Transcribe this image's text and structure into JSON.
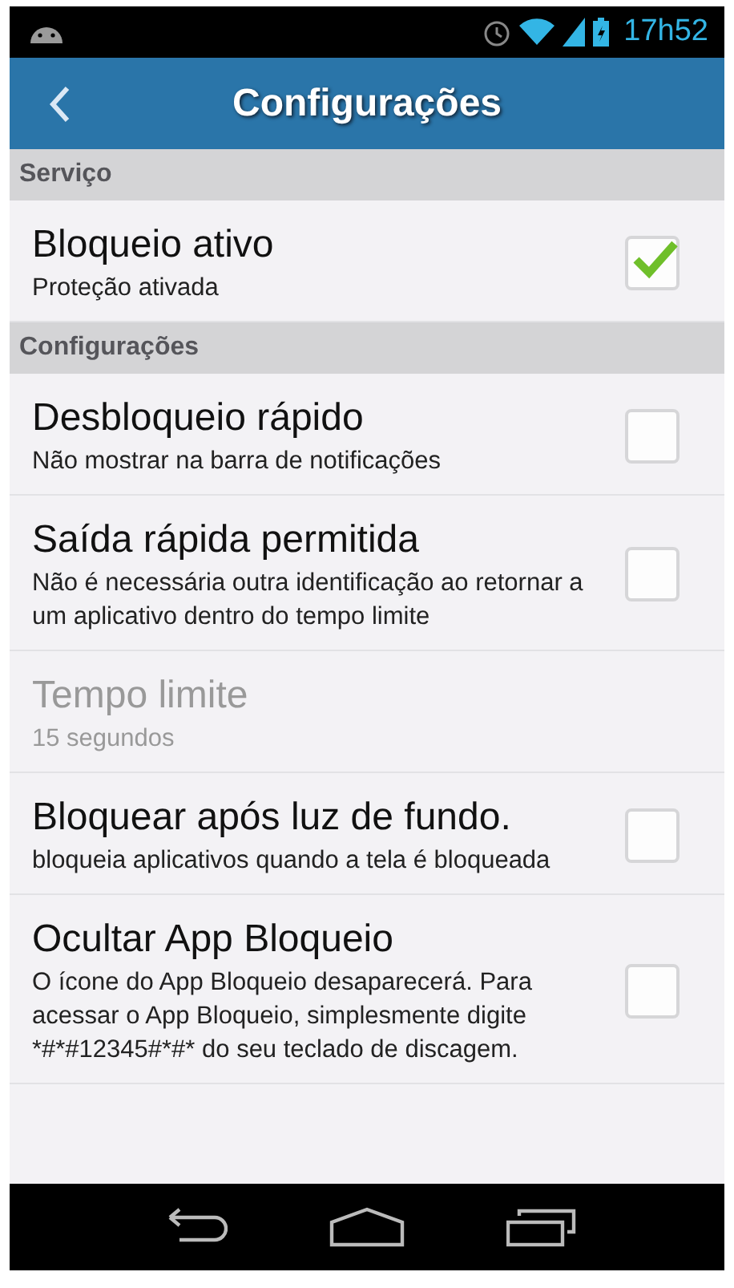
{
  "status_bar": {
    "time": "17h52"
  },
  "app_bar": {
    "title": "Configurações"
  },
  "sections": [
    {
      "header": "Serviço",
      "items": [
        {
          "kind": "checkbox",
          "title": "Bloqueio ativo",
          "summary": "Proteção ativada",
          "disabled": false,
          "checked": true
        }
      ]
    },
    {
      "header": "Configurações",
      "items": [
        {
          "kind": "checkbox",
          "title": "Desbloqueio rápido",
          "summary": "Não mostrar na barra de notificações",
          "disabled": false,
          "checked": false
        },
        {
          "kind": "checkbox",
          "title": "Saída rápida permitida",
          "summary": "Não é necessária outra identificação ao retornar a um aplicativo dentro do tempo limite",
          "disabled": false,
          "checked": false
        },
        {
          "kind": "plain",
          "title": "Tempo limite",
          "summary": "15 segundos",
          "disabled": true
        },
        {
          "kind": "checkbox",
          "title": "Bloquear após luz de fundo.",
          "summary": "bloqueia aplicativos quando a tela é bloqueada",
          "disabled": false,
          "checked": false
        },
        {
          "kind": "checkbox",
          "title": "Ocultar App Bloqueio",
          "summary": "O ícone do App Bloqueio desaparecerá. Para acessar o App Bloqueio, simplesmente digite *#*#12345#*#* do seu teclado de discagem.",
          "disabled": false,
          "checked": false
        }
      ]
    }
  ]
}
